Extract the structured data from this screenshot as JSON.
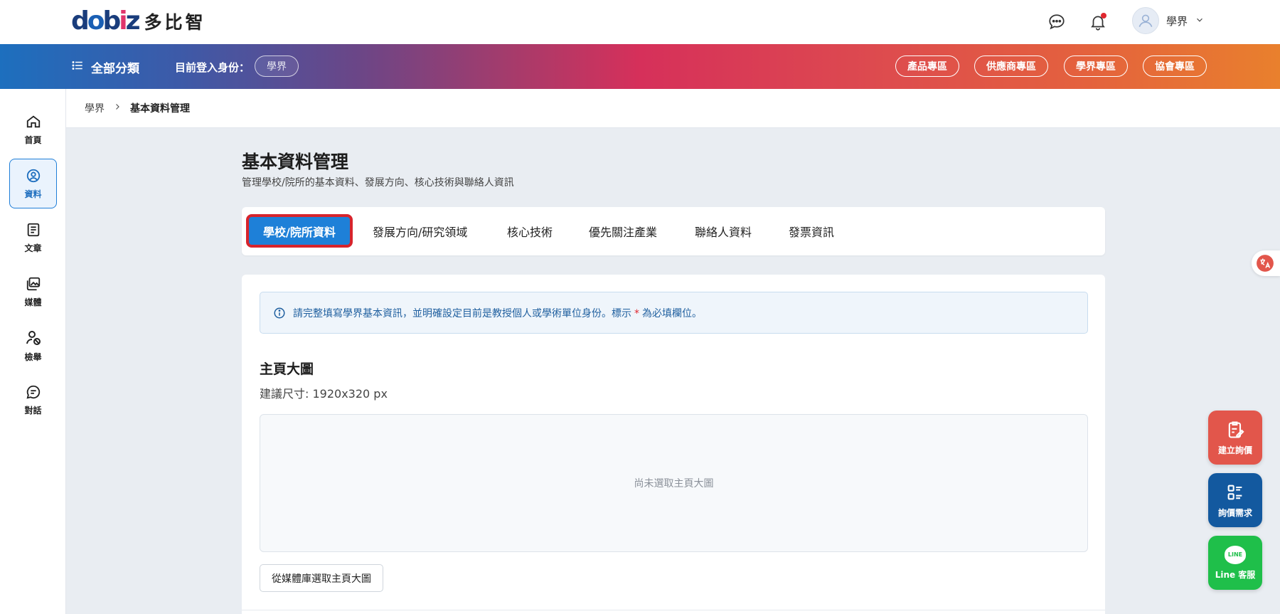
{
  "header": {
    "logo_mark": "dobiz",
    "logo_text": "多比智",
    "user_name": "學界"
  },
  "nav": {
    "all_categories": "全部分類",
    "identity_label": "目前登入身份：",
    "identity_value": "學界",
    "zones": [
      "產品專區",
      "供應商專區",
      "學界專區",
      "協會專區"
    ]
  },
  "sidebar": {
    "items": [
      {
        "label": "首頁",
        "icon": "home-icon"
      },
      {
        "label": "資料",
        "icon": "user-circle-icon"
      },
      {
        "label": "文章",
        "icon": "document-icon"
      },
      {
        "label": "媒體",
        "icon": "media-icon"
      },
      {
        "label": "檢舉",
        "icon": "report-user-icon"
      },
      {
        "label": "對話",
        "icon": "chat-icon"
      }
    ],
    "active_index": 1
  },
  "breadcrumb": {
    "parent": "學界",
    "current": "基本資料管理"
  },
  "page": {
    "title": "基本資料管理",
    "subtitle": "管理學校/院所的基本資料、發展方向、核心技術與聯絡人資訊"
  },
  "tabs": [
    {
      "label": "學校/院所資料",
      "active": true
    },
    {
      "label": "發展方向/研究領域",
      "active": false
    },
    {
      "label": "核心技術",
      "active": false
    },
    {
      "label": "優先關注產業",
      "active": false
    },
    {
      "label": "聯絡人資料",
      "active": false
    },
    {
      "label": "發票資訊",
      "active": false
    }
  ],
  "form": {
    "notice_before": "請完整填寫學界基本資訊，並明確設定目前是教授個人或學術單位身份。標示",
    "notice_required_mark": "*",
    "notice_after": "為必填欄位。",
    "banner_section_title": "主頁大圖",
    "banner_hint": "建議尺寸: 1920x320 px",
    "banner_empty": "尚未選取主頁大圖",
    "pick_button": "從媒體庫選取主頁大圖"
  },
  "floating": {
    "inquiry": "建立詢價",
    "demand": "詢價需求",
    "line": "Line 客服",
    "line_badge": "LINE"
  },
  "colors": {
    "accent": "#1e80d8",
    "highlight_border": "#d7242c",
    "inquiry": "#e2564b",
    "demand": "#13599f",
    "line": "#1fbf4a",
    "notification_dot": "#e0272f"
  }
}
